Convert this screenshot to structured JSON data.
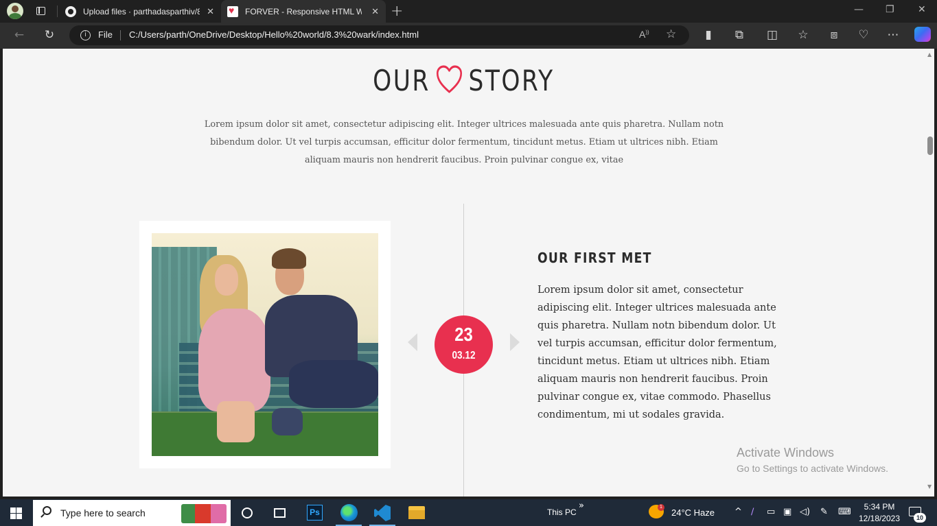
{
  "browser": {
    "tabs": [
      {
        "title": "Upload files · parthadasparthiv/8",
        "favicon": "github-icon",
        "active": false
      },
      {
        "title": "FORVER - Responsive HTML Wed",
        "favicon": "heart-favicon-icon",
        "active": true
      }
    ],
    "address": {
      "scheme_label": "File",
      "url": "C:/Users/parth/OneDrive/Desktop/Hello%20world/8.3%20wark/index.html"
    },
    "toolbar_icons": [
      "back-icon",
      "refresh-icon",
      "read-aloud-icon",
      "favorite-star-icon",
      "extension-t-icon",
      "extensions-icon",
      "split-screen-icon",
      "favorites-icon",
      "collections-icon",
      "browser-essentials-icon",
      "more-icon",
      "copilot-icon"
    ]
  },
  "page": {
    "title_left": "OUR",
    "title_right": "STORY",
    "title_icon": "heart-outline-icon",
    "accent_color": "#e8304f",
    "intro": "Lorem ipsum dolor sit amet, consectetur adipiscing elit. Integer ultrices malesuada ante quis pharetra. Nullam notn bibendum dolor. Ut vel turpis accumsan, efficitur dolor fermentum, tincidunt metus. Etiam ut ultrices nibh. Etiam aliquam mauris non hendrerit faucibus. Proin pulvinar congue ex, vitae",
    "event": {
      "day": "23",
      "month": "03.12",
      "title": "OUR FIRST MET",
      "text": "Lorem ipsum dolor sit amet, consectetur adipiscing elit. Integer ultrices malesuada ante quis pharetra. Nullam notn bibendum dolor. Ut vel turpis accumsan, efficitur dolor fermentum, tincidunt metus. Etiam ut ultrices nibh. Etiam aliquam mauris non hendrerit faucibus. Proin pulvinar congue ex, vitae commodo. Phasellus condimentum, mi ut sodales gravida."
    }
  },
  "watermark": {
    "line1": "Activate Windows",
    "line2": "Go to Settings to activate Windows."
  },
  "taskbar": {
    "search_placeholder": "Type here to search",
    "ps_label": "Ps",
    "toolbar_label": "This PC",
    "toolbar_chevron": "»",
    "weather": "24°C  Haze",
    "weather_badge": "1",
    "time": "5:34 PM",
    "date": "12/18/2023",
    "notification_count": "10"
  }
}
